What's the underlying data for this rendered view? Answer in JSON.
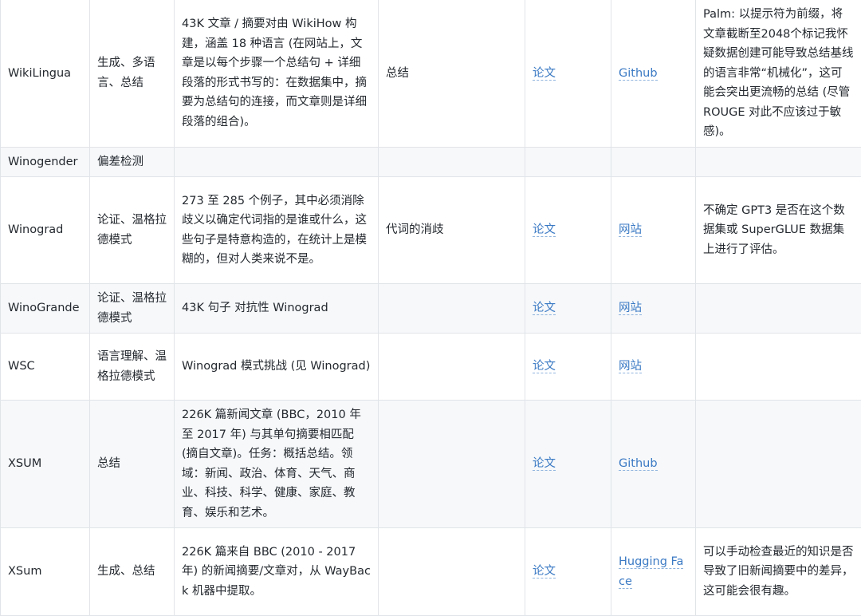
{
  "rows": [
    {
      "name": "WikiLingua",
      "tasks": "生成、多语言、总结",
      "description": "43K 文章 / 摘要对由 WikiHow 构建，涵盖 18 种语言 (在网站上，文章是以每个步骤一个总结句 + 详细段落的形式书写的：在数据集中，摘要为总结句的连接，而文章则是详细段落的组合)。",
      "use": "总结",
      "paper": "论文",
      "resource": "Github",
      "notes": "Palm: 以提示符为前缀，将文章截断至2048个标记我怀疑数据创建可能导致总结基线的语言非常“机械化”，这可能会突出更流畅的总结 (尽管 ROUGE 对此不应该过于敏感)。"
    },
    {
      "name": "Winogender",
      "tasks": "偏差检测",
      "description": "",
      "use": "",
      "paper": "",
      "resource": "",
      "notes": ""
    },
    {
      "name": "Winograd",
      "tasks": "论证、温格拉德模式",
      "description": "273 至 285 个例子，其中必须消除歧义以确定代词指的是谁或什么，这些句子是特意构造的，在统计上是模糊的，但对人类来说不是。",
      "use": "代词的消歧",
      "paper": "论文",
      "resource": "网站",
      "notes": "不确定 GPT3 是否在这个数据集或 SuperGLUE 数据集上进行了评估。"
    },
    {
      "name": "WinoGrande",
      "tasks": "论证、温格拉德模式",
      "description": "43K 句子 对抗性 Winograd",
      "use": "",
      "paper": "论文",
      "resource": "网站",
      "notes": ""
    },
    {
      "name": "WSC",
      "tasks": "语言理解、温格拉德模式",
      "description": "Winograd 模式挑战 (见 Winograd)",
      "use": "",
      "paper": "论文",
      "resource": "网站",
      "notes": ""
    },
    {
      "name": "XSUM",
      "tasks": "总结",
      "description": "226K 篇新闻文章 (BBC，2010 年至 2017 年) 与其单句摘要相匹配 (摘自文章)。任务：概括总结。领域：新闻、政治、体育、天气、商业、科技、科学、健康、家庭、教育、娱乐和艺术。",
      "use": "",
      "paper": "论文",
      "resource": "Github",
      "notes": ""
    },
    {
      "name": "XSum",
      "tasks": "生成、总结",
      "description": "226K 篇来自 BBC (2010 - 2017 年) 的新闻摘要/文章对，从 WayBack 机器中提取。",
      "use": "",
      "paper": "论文",
      "resource": "Hugging Face",
      "notes": "可以手动检查最近的知识是否导致了旧新闻摘要中的差异，这可能会很有趣。"
    }
  ]
}
